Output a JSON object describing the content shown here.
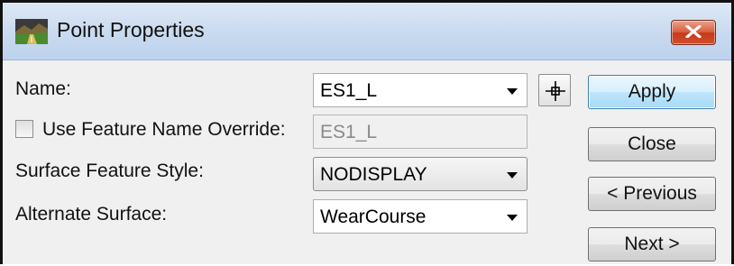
{
  "window": {
    "title": "Point Properties",
    "app_icon": "landscape-icon",
    "close_icon": "close-x-icon",
    "close_color": "#c6391a"
  },
  "form": {
    "name": {
      "label": "Name:",
      "value": "ES1_L",
      "pick_icon": "crosshair-icon"
    },
    "feature_name_override": {
      "label": "Use Feature Name Override:",
      "checked": false,
      "value": "ES1_L"
    },
    "surface_feature_style": {
      "label": "Surface Feature Style:",
      "value": "NODISPLAY"
    },
    "alternate_surface": {
      "label": "Alternate Surface:",
      "value": "WearCourse"
    }
  },
  "buttons": {
    "apply": "Apply",
    "close": "Close",
    "previous": "< Previous",
    "next": "Next >"
  },
  "colors": {
    "default_button_border": "#3c7fb1",
    "dialog_background": "#f0f0f0"
  }
}
